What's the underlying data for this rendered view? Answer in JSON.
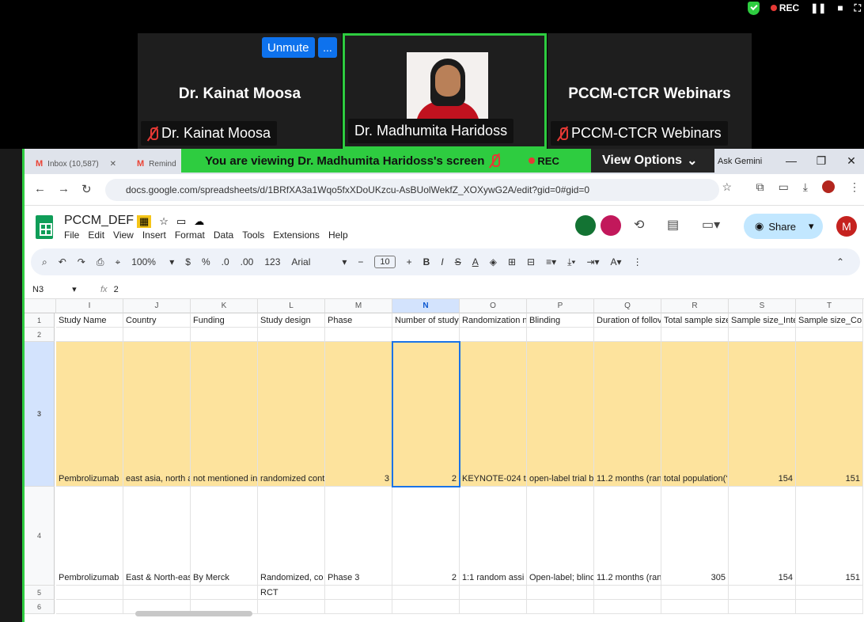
{
  "meeting": {
    "status_rec": "REC",
    "tiles": [
      {
        "name": "Dr. Kainat Moosa",
        "label": "Dr. Kainat Moosa"
      },
      {
        "name": "",
        "label": "Dr. Madhumita Haridoss"
      },
      {
        "name": "PCCM-CTCR Webinars",
        "label": "PCCM-CTCR Webinars"
      }
    ],
    "unmute_label": "Unmute",
    "more_label": "...",
    "banner_text": "You are viewing  Dr. Madhumita Haridoss's screen",
    "banner_rec": "REC",
    "view_options": "View Options"
  },
  "browser": {
    "tabs": [
      "Inbox (10,587)",
      "Remind"
    ],
    "ask_gemini": "Ask Gemini",
    "url": "docs.google.com/spreadsheets/d/1BRfXA3a1Wqo5fxXDoUKzcu-AsBUolWekfZ_XOXywG2A/edit?gid=0#gid=0"
  },
  "sheets": {
    "title": "PCCM_DEF",
    "menus": [
      "File",
      "Edit",
      "View",
      "Insert",
      "Format",
      "Data",
      "Tools",
      "Extensions",
      "Help"
    ],
    "share_label": "Share",
    "avatar_letter": "M",
    "toolbar": {
      "zoom": "100%",
      "currency": "$",
      "percent": "%",
      "decimal_dec": ".0",
      "decimal_inc": ".00",
      "format_num": "123",
      "font": "Arial",
      "font_size": "10"
    },
    "name_box": "N3",
    "formula": "2",
    "columns": [
      "I",
      "J",
      "K",
      "L",
      "M",
      "N",
      "O",
      "P",
      "Q",
      "R",
      "S",
      "T"
    ],
    "rows": [
      {
        "num": "1",
        "cells": [
          "Study Name",
          "Country",
          "Funding",
          "Study design",
          "Phase",
          "Number of study",
          "Randomization n",
          "Blinding",
          "Duration of follov",
          "Total sample size",
          "Sample size_Inte",
          "Sample size_Co"
        ]
      },
      {
        "num": "2",
        "cells": [
          "",
          "",
          "",
          "",
          "",
          "",
          "",
          "",
          "",
          "",
          "",
          ""
        ]
      },
      {
        "num": "3",
        "cells": [
          "Pembrolizumab  Non–Small-Cell",
          "east asia, north a",
          "not mentioned in",
          "randomized cont",
          "3",
          "2",
          "KEYNOTE-024 t",
          "open-label trial b",
          "11.2 months (ran",
          "total population(‘",
          "154",
          "151"
        ]
      },
      {
        "num": "4",
        "cells": [
          "Pembrolizumab  ",
          "East & North-eas",
          "By Merck",
          "Randomized, co",
          "Phase 3",
          "2",
          "1:1 random assi",
          "Open-label; blinc",
          "11.2 months (ran",
          "305",
          "154",
          "151"
        ]
      },
      {
        "num": "5",
        "cells": [
          "",
          "",
          "",
          "RCT",
          "",
          "",
          "",
          "",
          "",
          "",
          "",
          ""
        ]
      },
      {
        "num": "6",
        "cells": [
          "",
          "",
          "",
          "",
          "",
          "",
          "",
          "",
          "",
          "",
          "",
          ""
        ]
      }
    ]
  }
}
